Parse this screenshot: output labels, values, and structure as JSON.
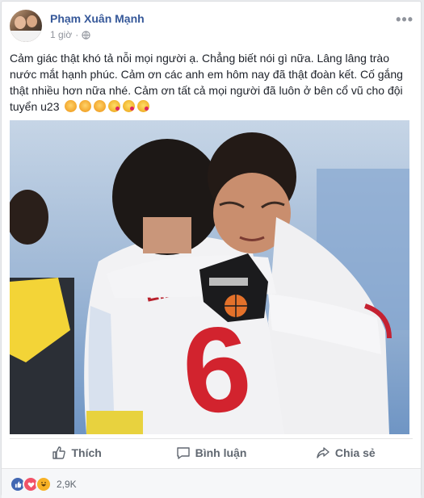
{
  "post": {
    "author": "Phạm Xuân Mạnh",
    "time": "1 giờ",
    "text": "Cảm giác thật khó tả nỗi mọi người ạ. Chẳng biết nói gì nữa. Lâng lâng trào nước mắt hạnh phúc. Cảm ơn các anh em hôm nay đã thật đoàn kết. Cố gắng thật nhiều hơn nữa nhé. Cảm ơn tất cả mọi người đã luôn ở bên cổ vũ cho đội tuyển u23",
    "emojis": [
      "clapping-hands",
      "clapping-hands",
      "clapping-hands",
      "face-blowing-kiss",
      "face-blowing-kiss",
      "face-blowing-kiss"
    ]
  },
  "photo": {
    "jersey_text": "L.X.TR",
    "jersey_number": "6"
  },
  "actions": {
    "like": "Thích",
    "comment": "Bình luận",
    "share": "Chia sẻ"
  },
  "reactions": {
    "count": "2,9K",
    "icons": [
      "like",
      "love",
      "haha"
    ]
  },
  "colors": {
    "author": "#365899",
    "meta": "#90949c",
    "like_blue": "#4267b2",
    "love_red": "#f25268",
    "haha_yellow": "#f7b125"
  }
}
